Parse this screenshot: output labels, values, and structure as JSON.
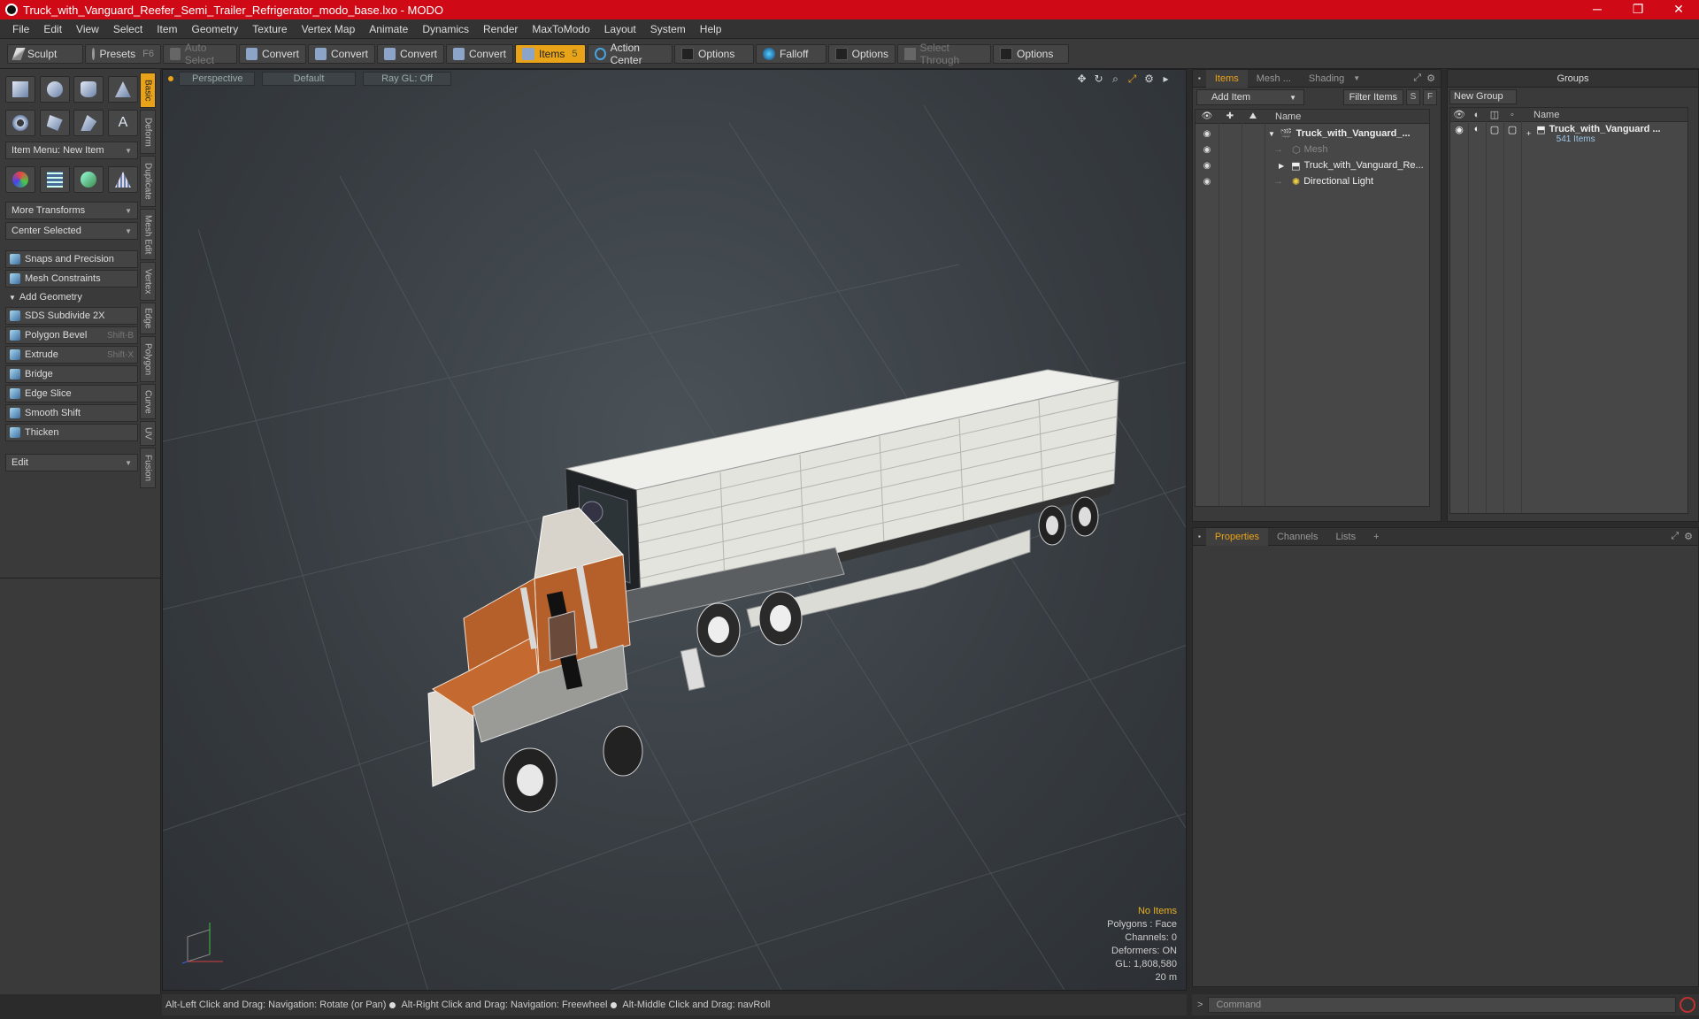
{
  "window": {
    "title": "Truck_with_Vanguard_Reefer_Semi_Trailer_Refrigerator_modo_base.lxo - MODO",
    "controls": [
      "─",
      "❐",
      "✕"
    ]
  },
  "menu": [
    "File",
    "Edit",
    "View",
    "Select",
    "Item",
    "Geometry",
    "Texture",
    "Vertex Map",
    "Animate",
    "Dynamics",
    "Render",
    "MaxToModo",
    "Layout",
    "System",
    "Help"
  ],
  "toolbar": {
    "sculpt": "Sculpt",
    "presets": "Presets",
    "presets_key": "F6",
    "auto_select": "Auto Select",
    "convert1": "Convert",
    "convert2": "Convert",
    "convert3": "Convert",
    "convert4": "Convert",
    "items": "Items",
    "items_key": "5",
    "action_center": "Action Center",
    "options1": "Options",
    "falloff": "Falloff",
    "options2": "Options",
    "select_through": "Select Through",
    "options3": "Options"
  },
  "left": {
    "item_menu": "Item Menu: New Item",
    "more_transforms": "More Transforms",
    "center_selected": "Center Selected",
    "snaps": "Snaps and Precision",
    "mesh_constraints": "Mesh Constraints",
    "add_geometry": "Add Geometry",
    "tools": [
      {
        "label": "SDS Subdivide 2X",
        "key": ""
      },
      {
        "label": "Polygon Bevel",
        "key": "Shift-B"
      },
      {
        "label": "Extrude",
        "key": "Shift-X"
      },
      {
        "label": "Bridge",
        "key": ""
      },
      {
        "label": "Edge Slice",
        "key": ""
      },
      {
        "label": "Smooth Shift",
        "key": ""
      },
      {
        "label": "Thicken",
        "key": ""
      }
    ],
    "edit": "Edit",
    "sidetabs": [
      "Basic",
      "Deform",
      "Duplicate",
      "Mesh Edit",
      "Vertex",
      "Edge",
      "Polygon",
      "Curve",
      "UV",
      "Fusion"
    ]
  },
  "viewport": {
    "view": "Perspective",
    "shading": "Default",
    "raygl": "Ray GL: Off",
    "info": {
      "selection": "No Items",
      "polygons": "Polygons : Face",
      "channels": "Channels: 0",
      "deformers": "Deformers: ON",
      "gl": "GL: 1,808,580",
      "scale": "20 m"
    }
  },
  "status": {
    "hint1": "Alt-Left Click and Drag: Navigation: Rotate (or Pan)",
    "hint2": "Alt-Right Click and Drag: Navigation: Freewheel",
    "hint3": "Alt-Middle Click and Drag: navRoll"
  },
  "items_panel": {
    "tabs": [
      "Items",
      "Mesh ...",
      "Shading"
    ],
    "add_item": "Add Item",
    "filter_items": "Filter Items",
    "s": "S",
    "f": "F",
    "col_name": "Name",
    "rows": [
      {
        "label": "Truck_with_Vanguard_...",
        "bold": true,
        "indent": 0
      },
      {
        "label": "Mesh",
        "bold": false,
        "indent": 1,
        "dim": true
      },
      {
        "label": "Truck_with_Vanguard_Re...",
        "bold": false,
        "indent": 1
      },
      {
        "label": "Directional Light",
        "bold": false,
        "indent": 1
      }
    ]
  },
  "groups_panel": {
    "title": "Groups",
    "new_group": "New Group",
    "col_name": "Name",
    "group_name": "Truck_with_Vanguard ...",
    "group_count": "541 Items"
  },
  "props_panel": {
    "tabs": [
      "Properties",
      "Channels",
      "Lists",
      "+"
    ]
  },
  "command": {
    "placeholder": "Command",
    "prompt": ">"
  },
  "colors": {
    "accent": "#e8a318",
    "titlebar": "#cf0a16",
    "truck_orange": "#b5602a"
  }
}
